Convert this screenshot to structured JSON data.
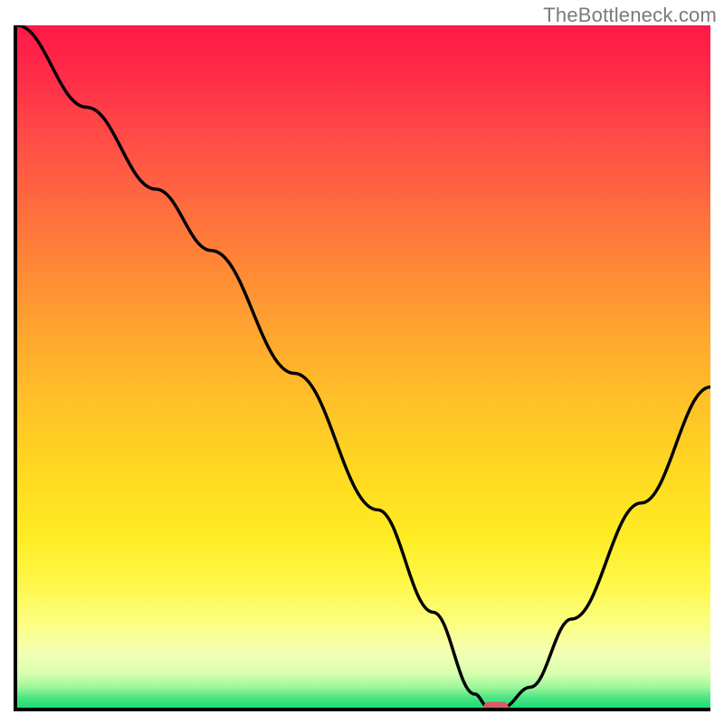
{
  "attribution": "TheBottleneck.com",
  "chart_data": {
    "type": "line",
    "title": "",
    "xlabel": "",
    "ylabel": "",
    "xlim": [
      0,
      100
    ],
    "ylim": [
      0,
      100
    ],
    "series": [
      {
        "name": "curve",
        "x": [
          0,
          10,
          20,
          28,
          40,
          52,
          60,
          66,
          68,
          70,
          74,
          80,
          90,
          100
        ],
        "values": [
          100,
          88,
          76,
          67,
          49,
          29,
          14,
          2,
          0,
          0,
          3,
          13,
          30,
          47
        ]
      }
    ],
    "marker": {
      "x": 69,
      "y": 0
    },
    "gradient_colors": {
      "top": "#ff1846",
      "mid_high": "#ffa82e",
      "mid": "#ffec24",
      "low": "#f3ffb3",
      "bottom": "#1adf74"
    },
    "marker_color": "#d95a63"
  }
}
